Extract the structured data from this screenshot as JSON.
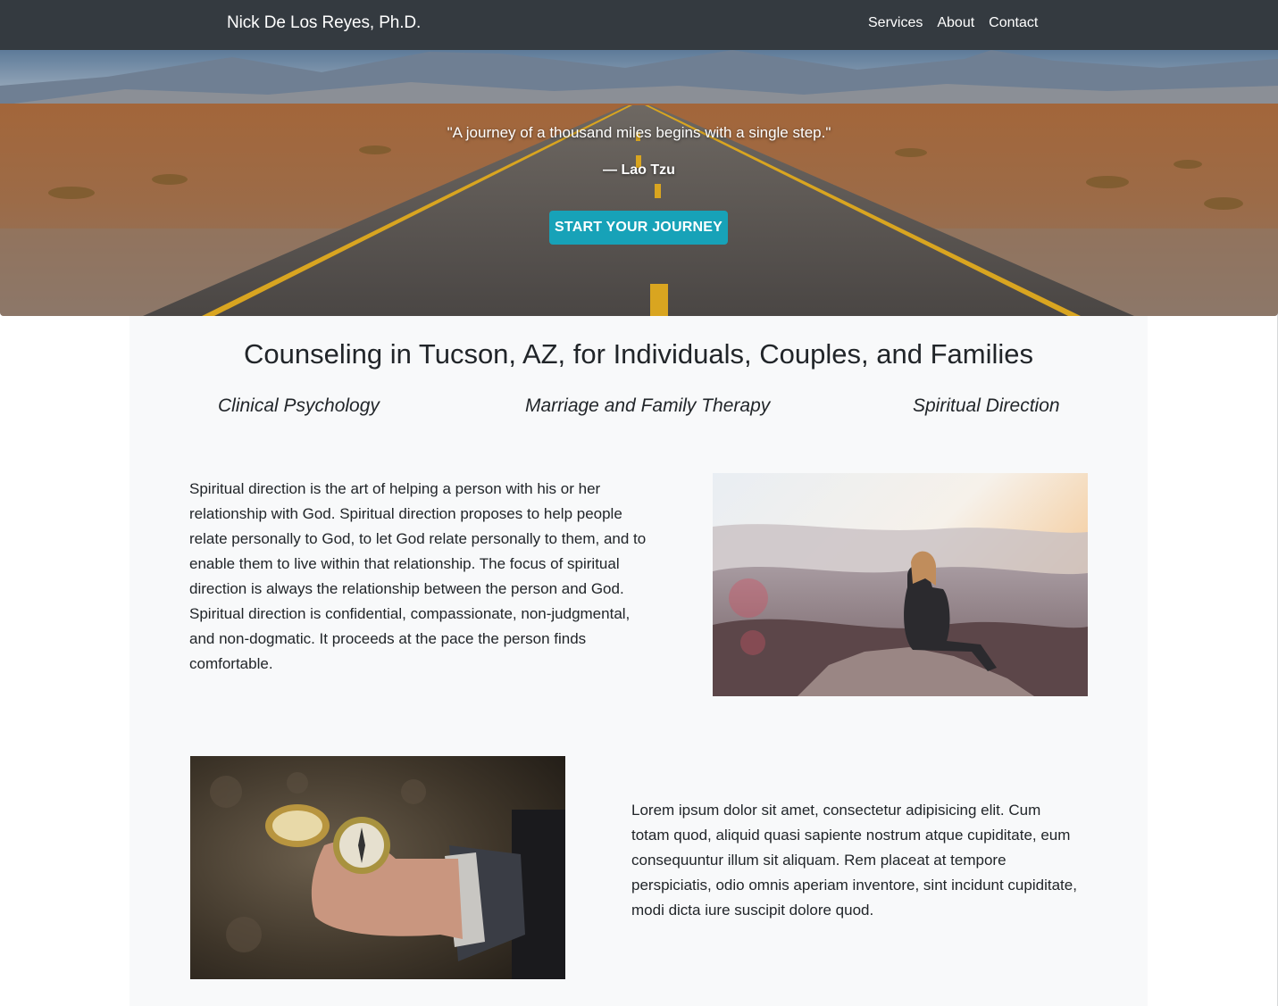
{
  "navbar": {
    "brand": "Nick De Los Reyes, Ph.D.",
    "links": [
      "Services",
      "About",
      "Contact"
    ],
    "background": "#343a40"
  },
  "hero": {
    "quote": "\"A journey of a thousand miles begins with a single step.\"",
    "author": "— Lao Tzu",
    "button_label": "START YOUR JOURNEY",
    "button_color": "#17a2b8"
  },
  "main": {
    "title": "Counseling in Tucson, AZ, for Individuals, Couples, and Families",
    "services": [
      "Clinical Psychology",
      "Marriage and Family Therapy",
      "Spiritual Direction"
    ],
    "spiritual_direction_text": "Spiritual direction is the art of helping a person with his or her relationship with God. Spiritual direction proposes to help people relate personally to God, to let God relate personally to them, and to enable them to live within that relationship. The focus of spiritual direction is always the relationship between the person and God. Spiritual direction is confidential, compassionate, non-judgmental, and non-dogmatic. It proceeds at the pace the person finds comfortable.",
    "lorem_text": "Lorem ipsum dolor sit amet, consectetur adipisicing elit. Cum totam quod, aliquid quasi sapiente nostrum atque cupiditate, eum consequuntur illum sit aliquam. Rem placeat at tempore perspiciatis, odio omnis aperiam inventore, sint incidunt cupiditate, modi dicta iure suscipit dolore quod.",
    "background": "#f8f9fa"
  },
  "images": {
    "hero": "desert-road-mountains",
    "photo_1": "woman-sitting-on-mountain-rock",
    "photo_2": "hand-holding-compass"
  }
}
